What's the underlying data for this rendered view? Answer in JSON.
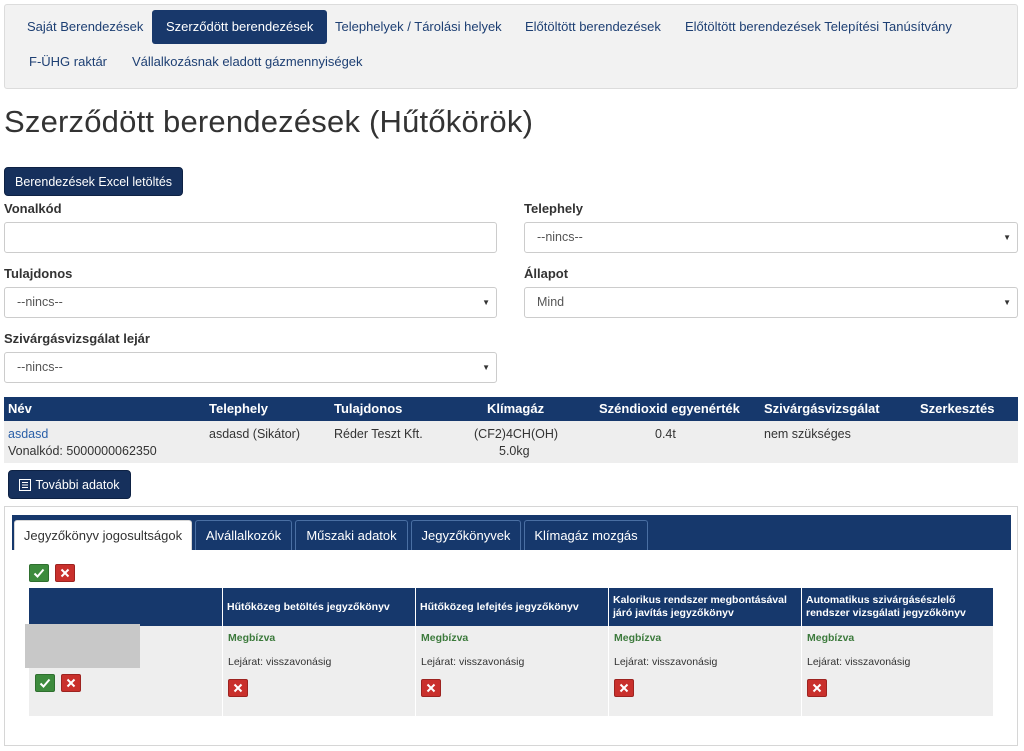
{
  "nav": {
    "items": [
      "Saját Berendezések",
      "Szerződött berendezések",
      "Telephelyek / Tárolási helyek",
      "Előtöltött berendezések",
      "Előtöltött berendezések Telepítési Tanúsítvány",
      "F-ÜHG raktár",
      "Vállalkozásnak eladott gázmennyiségek"
    ],
    "active_index": 1
  },
  "page": {
    "title": "Szerződött berendezések (Hűtőkörök)",
    "excel_button": "Berendezések Excel letöltés"
  },
  "filters": {
    "barcode_label": "Vonalkód",
    "barcode_value": "",
    "site_label": "Telephely",
    "site_value": "--nincs--",
    "owner_label": "Tulajdonos",
    "owner_value": "--nincs--",
    "state_label": "Állapot",
    "state_value": "Mind",
    "leak_label": "Szivárgásvizsgálat lejár",
    "leak_value": "--nincs--"
  },
  "table": {
    "headers": [
      "Név",
      "Telephely",
      "Tulajdonos",
      "Klímagáz",
      "Széndioxid egyenérték",
      "Szivárgásvizsgálat",
      "Szerkesztés"
    ],
    "row": {
      "name": "asdasd",
      "barcode": "Vonalkód: 5000000062350",
      "site": "asdasd (Sikátor)",
      "owner": "Réder Teszt Kft.",
      "gas": "(CF2)4CH(OH)",
      "gas_amount": "5.0kg",
      "co2": "0.4t",
      "leak": "nem szükséges"
    },
    "more_button": "További adatok"
  },
  "tabs": [
    "Jegyzőkönyv jogosultságok",
    "Alvállalkozók",
    "Műszaki adatok",
    "Jegyzőkönyvek",
    "Klímagáz mozgás"
  ],
  "permissions": {
    "headers": [
      "Hűtőközeg betöltés jegyzőkönyv",
      "Hűtőközeg lefejtés jegyzőkönyv",
      "Kalorikus rendszer megbontásával járó javítás jegyzőkönyv",
      "Automatikus szivárgásészlelő rendszer vizsgálati jegyzőkönyv"
    ],
    "cells": [
      {
        "status": "Megbízva",
        "expiry": "Lejárat: visszavonásig"
      },
      {
        "status": "Megbízva",
        "expiry": "Lejárat: visszavonásig"
      },
      {
        "status": "Megbízva",
        "expiry": "Lejárat: visszavonásig"
      },
      {
        "status": "Megbízva",
        "expiry": "Lejárat: visszavonásig"
      }
    ]
  },
  "colors": {
    "primary": "#16386c",
    "success": "#3d8b3d",
    "danger": "#c9302c",
    "status_green": "#3c7a3c"
  }
}
